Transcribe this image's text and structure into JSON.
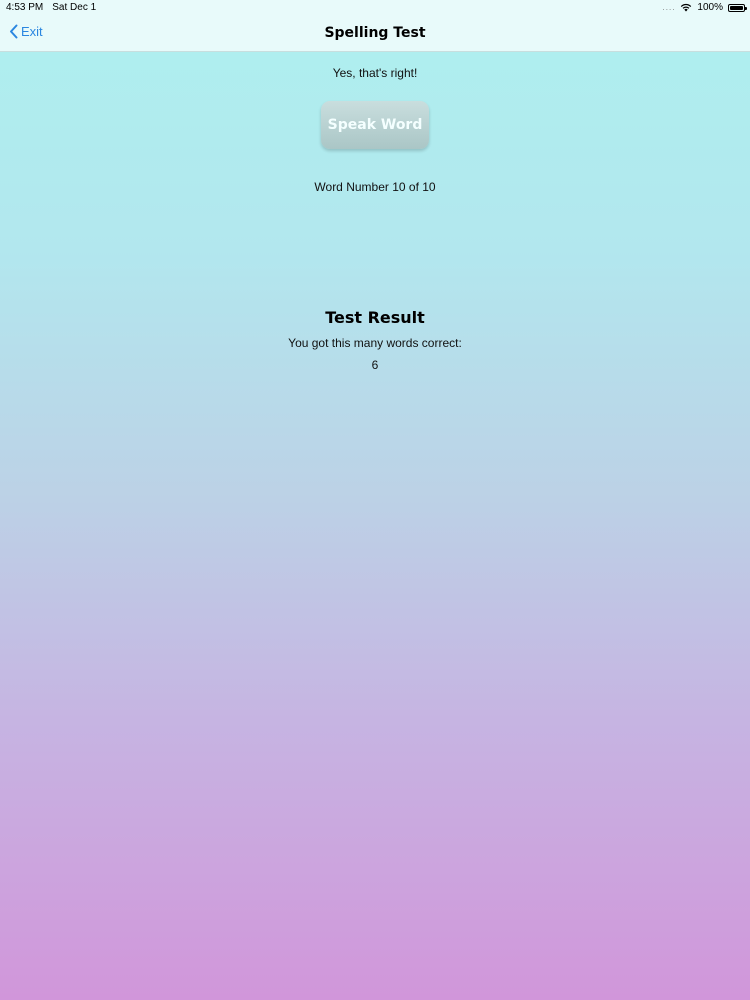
{
  "status_bar": {
    "time": "4:53 PM",
    "date": "Sat Dec 1",
    "signal": "....",
    "battery": "100%",
    "icons": [
      "wifi-icon",
      "battery-icon"
    ]
  },
  "nav": {
    "back_label": "Exit",
    "title": "Spelling Test",
    "accent_color": "#2a86e0"
  },
  "main": {
    "feedback": "Yes, that's right!",
    "speak_button_label": "Speak Word",
    "word_number": "Word Number 10 of 10"
  },
  "result": {
    "title": "Test Result",
    "text": "You got this many words correct:",
    "score": "6"
  },
  "colors": {
    "gradient_top": "#aef0ef",
    "gradient_bottom": "#d196da"
  }
}
